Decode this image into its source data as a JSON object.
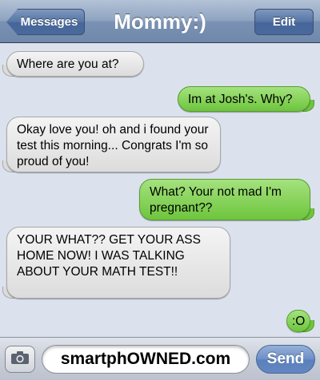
{
  "header": {
    "back_label": "Messages",
    "title": "Mommy:)",
    "edit_label": "Edit"
  },
  "messages": [
    {
      "side": "incoming",
      "text": "Where are you at?"
    },
    {
      "side": "outgoing",
      "text": "Im at Josh's. Why?"
    },
    {
      "side": "incoming",
      "text": "Okay love you! oh and i found your test this morning... Congrats I'm so proud of you!"
    },
    {
      "side": "outgoing",
      "text": "What? Your not mad I'm pregnant??"
    },
    {
      "side": "incoming",
      "text": "YOUR WHAT?? GET YOUR ASS HOME NOW! I WAS TALKING ABOUT YOUR MATH TEST!!"
    },
    {
      "side": "outgoing",
      "text": ":O"
    }
  ],
  "composer": {
    "camera_icon": "camera-icon",
    "input_value": "smartphOWNED.com",
    "send_label": "Send"
  },
  "colors": {
    "incoming_bubble": "#dcdcdc",
    "outgoing_bubble": "#6ec53d",
    "background": "#dbe2ed",
    "header": "#6f88ab"
  }
}
